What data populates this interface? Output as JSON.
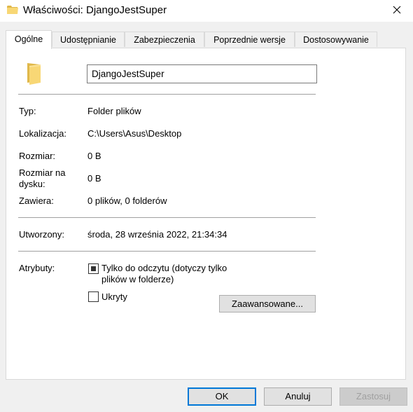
{
  "window": {
    "title": "Właściwości: DjangoJestSuper",
    "icon": "folder-icon",
    "close_icon": "close-icon"
  },
  "tabs": [
    {
      "label": "Ogólne",
      "active": true
    },
    {
      "label": "Udostępnianie",
      "active": false
    },
    {
      "label": "Zabezpieczenia",
      "active": false
    },
    {
      "label": "Poprzednie wersje",
      "active": false
    },
    {
      "label": "Dostosowywanie",
      "active": false
    }
  ],
  "general": {
    "folder_icon": "folder-icon",
    "name_value": "DjangoJestSuper",
    "fields": [
      {
        "label": "Typ:",
        "value": "Folder plików"
      },
      {
        "label": "Lokalizacja:",
        "value": "C:\\Users\\Asus\\Desktop"
      },
      {
        "label": "Rozmiar:",
        "value": "0 B"
      },
      {
        "label": "Rozmiar na dysku:",
        "value": "0 B"
      },
      {
        "label": "Zawiera:",
        "value": "0 plików, 0 folderów"
      }
    ],
    "created": {
      "label": "Utworzony:",
      "value": "środa, 28 września 2022, 21:34:34"
    },
    "attributes": {
      "label": "Atrybuty:",
      "readonly": {
        "label": "Tylko do odczytu (dotyczy tylko plików w folderze)",
        "state": "indeterminate"
      },
      "hidden": {
        "label": "Ukryty",
        "checked": false
      },
      "advanced_button": "Zaawansowane..."
    }
  },
  "buttons": {
    "ok": "OK",
    "cancel": "Anuluj",
    "apply": "Zastosuj"
  },
  "colors": {
    "accent": "#0078d7",
    "folder": "#f8d775",
    "folder_dark": "#e0b84a"
  }
}
